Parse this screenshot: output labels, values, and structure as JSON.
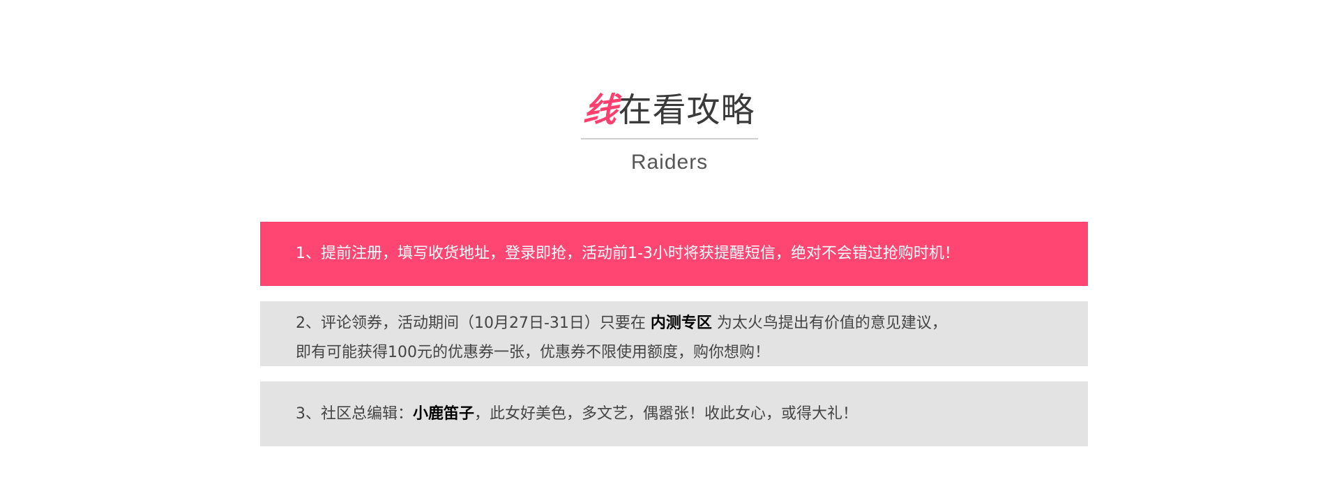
{
  "header": {
    "title_accent": "线",
    "title_rest": "在看攻略",
    "subtitle": "Raiders"
  },
  "tips": {
    "tip1": "1、提前注册，填写收货地址，登录即抢，活动前1-3小时将获提醒短信，绝对不会错过抢购时机！",
    "tip2": {
      "line1_before": "2、评论领券，活动期间（10月27日-31日）只要在 ",
      "line1_highlight": "内测专区",
      "line1_after": " 为太火鸟提出有价值的意见建议，",
      "line2": "即有可能获得100元的优惠券一张，优惠券不限使用额度，购你想购！"
    },
    "tip3": {
      "before": "3、社区总编辑：",
      "highlight": "小鹿笛子",
      "after": "，此女好美色，多文艺，偶嚣张！收此女心，或得大礼！"
    }
  },
  "colors": {
    "accent": "#ff4672",
    "panel_gray": "#e3e3e3",
    "text_dark": "#444444"
  }
}
